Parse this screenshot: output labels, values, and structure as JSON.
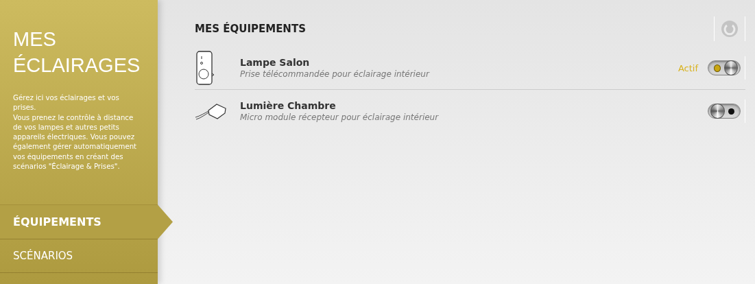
{
  "sidebar": {
    "title_lines": [
      "MES",
      "ÉCLAIRAGES"
    ],
    "description": [
      "Gérez ici vos éclairages et vos prises.",
      "Vous prenez le contrôle à distance de vos lampes et autres petits appareils électriques. Vous pouvez également gérer automatiquement vos équipements en créant des scénarios \"Éclairage & Prises\"."
    ],
    "nav": [
      {
        "label": "ÉQUIPEMENTS",
        "selected": true
      },
      {
        "label": "SCÉNARIOS",
        "selected": false
      }
    ]
  },
  "main": {
    "title": "MES ÉQUIPEMENTS",
    "devices": [
      {
        "kind": "plug",
        "name": "Lampe Salon",
        "description": "Prise télécommandée pour éclairage intérieur",
        "status": "Actif",
        "on": true
      },
      {
        "kind": "module",
        "name": "Lumière Chambre",
        "description": "Micro module récepteur pour éclairage intérieur",
        "on": false
      }
    ]
  }
}
